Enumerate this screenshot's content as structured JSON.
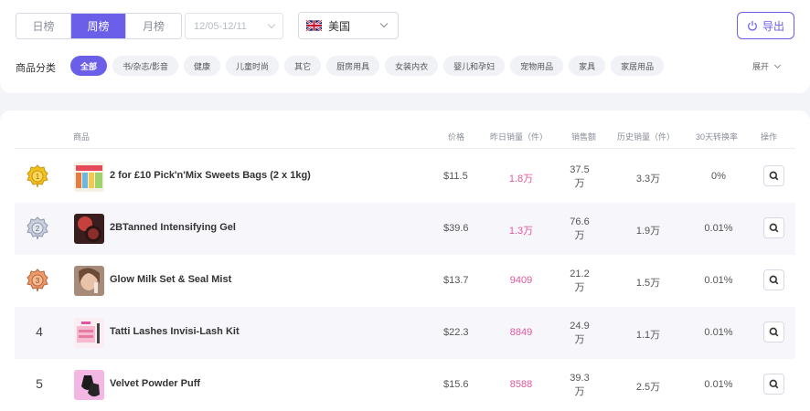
{
  "period_tabs": [
    "日榜",
    "周榜",
    "月榜"
  ],
  "active_period": "周榜",
  "date_range": "12/05-12/11",
  "country": {
    "name": "美国",
    "flag": "uk-flag"
  },
  "export_label": "导出",
  "category_label": "商品分类",
  "categories": [
    "全部",
    "书/杂志/影音",
    "健康",
    "儿童时尚",
    "其它",
    "厨房用具",
    "女装内衣",
    "婴儿和孕妇",
    "宠物用品",
    "家具",
    "家居用品"
  ],
  "expand_label": "展开",
  "colors": {
    "accent": "#6b5ee8",
    "sales": "#e0569e"
  },
  "table": {
    "headers": {
      "product": "商品",
      "price": "价格",
      "yesterday_sales": "昨日销量（件）",
      "sales_amount": "销售额",
      "history_sales": "历史销量（件）",
      "conversion": "30天转换率",
      "action": "操作"
    },
    "rows": [
      {
        "rank": "1",
        "medal": "gold-medal-icon",
        "name": "2 for £10 Pick'n'Mix Sweets Bags (2 x 1kg)",
        "price": "$11.5",
        "yesterday_sales": "1.8万",
        "amount_top": "37.5",
        "amount_unit": "万",
        "history_sales": "3.3万",
        "conversion": "0%"
      },
      {
        "rank": "2",
        "medal": "silver-medal-icon",
        "name": "2BTanned Intensifying Gel",
        "price": "$39.6",
        "yesterday_sales": "1.3万",
        "amount_top": "76.6",
        "amount_unit": "万",
        "history_sales": "1.9万",
        "conversion": "0.01%"
      },
      {
        "rank": "3",
        "medal": "bronze-medal-icon",
        "name": "Glow Milk Set & Seal Mist",
        "price": "$13.7",
        "yesterday_sales": "9409",
        "amount_top": "21.2",
        "amount_unit": "万",
        "history_sales": "1.5万",
        "conversion": "0.01%"
      },
      {
        "rank": "4",
        "medal": "",
        "name": "Tatti Lashes Invisi-Lash Kit",
        "price": "$22.3",
        "yesterday_sales": "8849",
        "amount_top": "24.9",
        "amount_unit": "万",
        "history_sales": "1.1万",
        "conversion": "0.01%"
      },
      {
        "rank": "5",
        "medal": "",
        "name": "Velvet Powder Puff",
        "price": "$15.6",
        "yesterday_sales": "8588",
        "amount_top": "39.3",
        "amount_unit": "万",
        "history_sales": "2.5万",
        "conversion": "0.01%"
      }
    ]
  }
}
